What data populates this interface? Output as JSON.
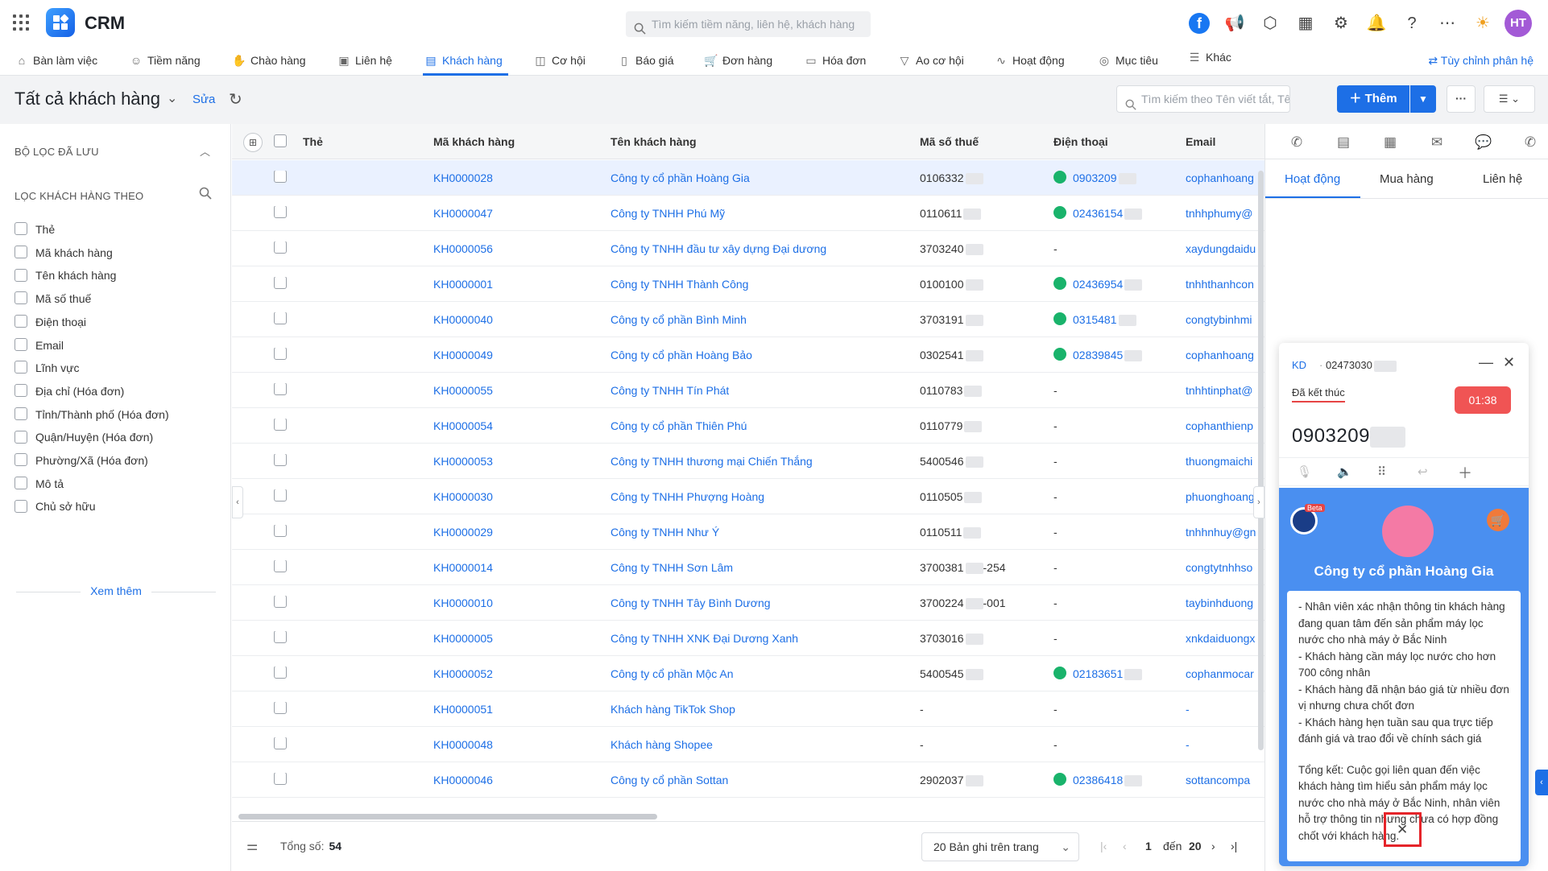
{
  "app": {
    "name": "CRM",
    "search_placeholder": "Tìm kiếm tiềm năng, liên hệ, khách hàng",
    "avatar": "HT"
  },
  "nav": {
    "items": [
      {
        "label": "Bàn làm việc",
        "icon": "home-icon"
      },
      {
        "label": "Tiềm năng",
        "icon": "user-icon"
      },
      {
        "label": "Chào hàng",
        "icon": "handshake-icon"
      },
      {
        "label": "Liên hệ",
        "icon": "contact-icon"
      },
      {
        "label": "Khách hàng",
        "icon": "building-icon"
      },
      {
        "label": "Cơ hội",
        "icon": "briefcase-icon"
      },
      {
        "label": "Báo giá",
        "icon": "document-icon"
      },
      {
        "label": "Đơn hàng",
        "icon": "cart-icon"
      },
      {
        "label": "Hóa đơn",
        "icon": "invoice-icon"
      },
      {
        "label": "Ao cơ hội",
        "icon": "funnel-icon"
      },
      {
        "label": "Hoạt động",
        "icon": "activity-icon"
      },
      {
        "label": "Mục tiêu",
        "icon": "target-icon"
      },
      {
        "label": "Khác",
        "icon": "menu-icon"
      }
    ],
    "active": "Khách hàng",
    "customize": "Tùy chỉnh phân hệ"
  },
  "page": {
    "title": "Tất cả khách hàng",
    "edit": "Sửa",
    "search_placeholder": "Tìm kiếm theo Tên viết tắt, Tên ...",
    "add": "Thêm"
  },
  "sidebar": {
    "saved_filters": "BỘ LỌC ĐÃ LƯU",
    "filter_by": "LỌC KHÁCH HÀNG THEO",
    "items": [
      "Thẻ",
      "Mã khách hàng",
      "Tên khách hàng",
      "Mã số thuế",
      "Điện thoại",
      "Email",
      "Lĩnh vực",
      "Địa chỉ (Hóa đơn)",
      "Tỉnh/Thành phố (Hóa đơn)",
      "Quận/Huyện (Hóa đơn)",
      "Phường/Xã (Hóa đơn)",
      "Mô tả",
      "Chủ sở hữu"
    ],
    "see_more": "Xem thêm"
  },
  "table": {
    "columns": [
      "Thẻ",
      "Mã khách hàng",
      "Tên khách hàng",
      "Mã số thuế",
      "Điện thoại",
      "Email"
    ],
    "rows": [
      {
        "code": "KH0000028",
        "name": "Công ty cổ phần Hoàng Gia",
        "tax": "0106332",
        "tax_suffix": "",
        "phone": "0903209",
        "email": "cophanhoang"
      },
      {
        "code": "KH0000047",
        "name": "Công ty TNHH Phú Mỹ",
        "tax": "0110611",
        "tax_suffix": "",
        "phone": "02436154",
        "email": "tnhhphumy@"
      },
      {
        "code": "KH0000056",
        "name": "Công ty TNHH đầu tư xây dựng Đại dương",
        "tax": "3703240",
        "tax_suffix": "",
        "phone": "-",
        "email": "xaydungdaidu"
      },
      {
        "code": "KH0000001",
        "name": "Công ty TNHH Thành Công",
        "tax": "0100100",
        "tax_suffix": "",
        "phone": "02436954",
        "email": "tnhhthanhcon"
      },
      {
        "code": "KH0000040",
        "name": "Công ty cổ phần Bình Minh",
        "tax": "3703191",
        "tax_suffix": "",
        "phone": "0315481",
        "email": "congtybinhmi"
      },
      {
        "code": "KH0000049",
        "name": "Công ty cổ phần Hoàng Bảo",
        "tax": "0302541",
        "tax_suffix": "",
        "phone": "02839845",
        "email": "cophanhoang"
      },
      {
        "code": "KH0000055",
        "name": "Công ty TNHH Tín Phát",
        "tax": "0110783",
        "tax_suffix": "",
        "phone": "-",
        "email": "tnhhtinphat@"
      },
      {
        "code": "KH0000054",
        "name": "Công ty cổ phần Thiên Phú",
        "tax": "0110779",
        "tax_suffix": "",
        "phone": "-",
        "email": "cophanthienp"
      },
      {
        "code": "KH0000053",
        "name": "Công ty TNHH thương mại Chiến Thắng",
        "tax": "5400546",
        "tax_suffix": "",
        "phone": "-",
        "email": "thuongmaichi"
      },
      {
        "code": "KH0000030",
        "name": "Công ty TNHH Phượng Hoàng",
        "tax": "0110505",
        "tax_suffix": "",
        "phone": "-",
        "email": "phuonghoang"
      },
      {
        "code": "KH0000029",
        "name": "Công ty TNHH Như Ý",
        "tax": "0110511",
        "tax_suffix": "",
        "phone": "-",
        "email": "tnhhnhuy@gn"
      },
      {
        "code": "KH0000014",
        "name": "Công ty TNHH Sơn Lâm",
        "tax": "3700381",
        "tax_suffix": "-254",
        "phone": "-",
        "email": "congtytnhhso"
      },
      {
        "code": "KH0000010",
        "name": "Công ty TNHH Tây Bình Dương",
        "tax": "3700224",
        "tax_suffix": "-001",
        "phone": "-",
        "email": "taybinhduong"
      },
      {
        "code": "KH0000005",
        "name": "Công ty TNHH XNK Đại Dương Xanh",
        "tax": "3703016",
        "tax_suffix": "",
        "phone": "-",
        "email": "xnkdaiduongx"
      },
      {
        "code": "KH0000052",
        "name": "Công ty cổ phần Mộc An",
        "tax": "5400545",
        "tax_suffix": "",
        "phone": "02183651",
        "email": "cophanmocar"
      },
      {
        "code": "KH0000051",
        "name": "Khách hàng TikTok Shop",
        "tax": "-",
        "tax_suffix": "",
        "phone": "-",
        "email": "-"
      },
      {
        "code": "KH0000048",
        "name": "Khách hàng Shopee",
        "tax": "-",
        "tax_suffix": "",
        "phone": "-",
        "email": "-"
      },
      {
        "code": "KH0000046",
        "name": "Công ty cổ phần Sottan",
        "tax": "2902037",
        "tax_suffix": "",
        "phone": "02386418",
        "email": "sottancompa"
      }
    ]
  },
  "footer": {
    "total_label": "Tổng số:",
    "total": "54",
    "per_page": "20 Bản ghi trên trang",
    "page": "1",
    "to": "đến",
    "last": "20"
  },
  "right_panel": {
    "tabs": [
      "Hoạt động",
      "Mua hàng",
      "Liên hệ"
    ],
    "active_tab": "Hoạt động"
  },
  "call_widget": {
    "tag": "KD",
    "line_number": "02473030",
    "status": "Đã kết thúc",
    "timer": "01:38",
    "number": "0903209",
    "beta": "Beta",
    "company": "Công ty cổ phần Hoàng Gia",
    "notes": [
      "- Nhân viên xác nhận thông tin khách hàng đang quan tâm đến sản phẩm máy lọc nước cho nhà máy ở Bắc Ninh",
      "- Khách hàng cần máy lọc nước cho hơn 700 công nhân",
      "- Khách hàng đã nhận báo giá từ nhiều đơn vị nhưng chưa chốt đơn",
      "- Khách hàng hẹn tuần sau qua trực tiếp đánh giá và trao đổi về chính sách giá",
      "",
      "Tổng kết: Cuộc gọi liên quan đến việc khách hàng tìm hiểu sản phẩm máy lọc nước cho nhà máy ở Bắc Ninh, nhân viên hỗ trợ thông tin nhưng chưa có hợp đồng chốt với khách hàng."
    ]
  },
  "colors": {
    "accent": "#1d6fe6",
    "timer": "#f05454",
    "phone": "#19b36b",
    "widget": "#4a8ff0",
    "highlight": "#e5242a"
  }
}
